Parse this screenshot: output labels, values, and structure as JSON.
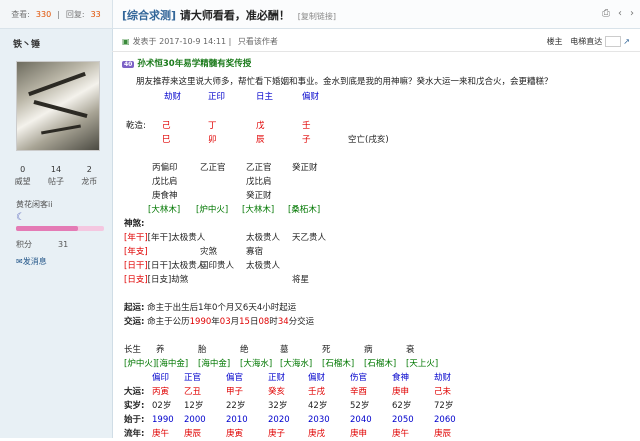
{
  "header": {
    "view_label": "查看:",
    "view_count": "330",
    "reply_label": "回复:",
    "reply_count": "33",
    "category": "[综合求测]",
    "title": "请大师看看，准必酬！",
    "copy_link": "[复制链接]"
  },
  "user": {
    "name": "铁丶锤",
    "stats": [
      {
        "value": "0",
        "label": "威望"
      },
      {
        "value": "14",
        "label": "帖子"
      },
      {
        "value": "2",
        "label": "龙币"
      }
    ],
    "motto": "黄花闲客ii",
    "level_progress": 0.7,
    "points_label": "积分",
    "points": "31",
    "message": "发消息"
  },
  "post": {
    "posted": "发表于 2017-10-9 14:11",
    "only_author": "只看该作者",
    "floor": "楼主",
    "elevator": "电梯直达"
  },
  "signature": {
    "tag": "40",
    "text": "孙术恒30年易学精髓有奖传授"
  },
  "content": {
    "intro": "朋友推荐来这里说大师多，帮忙看下婚姻和事业。金水到底是我的用神嘛？癸水大运一来和戊合火，会更糟糕？",
    "gods_top": [
      "劫财",
      "正印",
      "日主",
      "偏财"
    ],
    "qianyun": "乾造:",
    "stems": [
      "己",
      "丁",
      "戊",
      "壬"
    ],
    "branches": [
      "巳",
      "卯",
      "辰",
      "子"
    ],
    "kongwang": "空亡(戌亥)",
    "hidden1": [
      "丙偏印",
      "乙正官",
      "乙正官",
      "癸正财"
    ],
    "hidden2": [
      "戊比肩",
      "戊比肩"
    ],
    "hidden3": [
      "庚食神",
      "癸正财"
    ],
    "nayin": [
      "[大林木]",
      "[炉中火]",
      "[大林木]",
      "[桑柘木]"
    ],
    "shensha_label": "神煞:",
    "shensha_rows": [
      [
        "[年干]太极贵人",
        "",
        "太极贵人",
        "天乙贵人"
      ],
      [
        "[年支]",
        "灾煞",
        "寡宿",
        ""
      ],
      [
        "[日干]太极贵人",
        "国印贵人",
        "太极贵人",
        ""
      ],
      [
        "[日支]劫煞",
        "",
        "",
        "将星"
      ]
    ],
    "qiyun_label": "起运:",
    "qiyun_text": "命主于出生后1年0个月又6天4小时起运",
    "jiaoyun_label": "交运:",
    "jiaoyun_pre": "命主于公历",
    "jiaoyun_y": "1990",
    "jiaoyun_m": "03",
    "jiaoyun_d": "15",
    "jiaoyun_h": "08",
    "jiaoyun_min": "34",
    "jiaoyun_post": "分交运",
    "changsheng": [
      "长生",
      "养",
      "胎",
      "绝",
      "墓",
      "死",
      "病",
      "衰"
    ],
    "dayun_nayin": [
      "[炉中火]",
      "[海中金]",
      "[海中金]",
      "[大海水]",
      "[大海水]",
      "[石榴木]",
      "[石榴木]",
      "[天上火]"
    ],
    "dayun_gods": [
      "偏印",
      "正官",
      "偏官",
      "正财",
      "偏财",
      "伤官",
      "食神",
      "劫财"
    ],
    "dayun_label": "大运:",
    "dayun": [
      "丙寅",
      "乙丑",
      "甲子",
      "癸亥",
      "壬戌",
      "辛酉",
      "庚申",
      "己未"
    ],
    "age_label": "实岁:",
    "ages": [
      "02岁",
      "12岁",
      "22岁",
      "32岁",
      "42岁",
      "52岁",
      "62岁",
      "72岁"
    ],
    "start_label": "始于:",
    "starts": [
      "1990",
      "2000",
      "2010",
      "2020",
      "2030",
      "2040",
      "2050",
      "2060"
    ],
    "liunian_label": "流年:",
    "liunian": [
      "庚午",
      "庚辰",
      "庚寅",
      "庚子",
      "庚戌",
      "庚申",
      "庚午",
      "庚辰"
    ]
  }
}
